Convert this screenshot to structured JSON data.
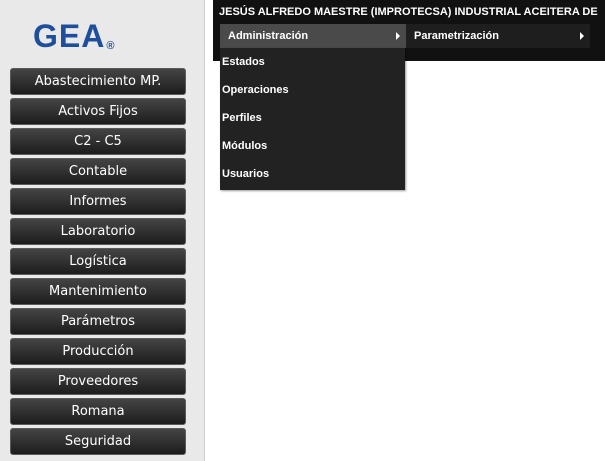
{
  "logo": {
    "text": "GEA",
    "mark": "®"
  },
  "header": {
    "user": "JESÚS ALFREDO MAESTRE (IMPROTECSA) INDUSTRIAL ACEITERA DE"
  },
  "top_menu": [
    {
      "label": "Administración",
      "has_submenu": true,
      "active": true
    },
    {
      "label": "Parametrización",
      "has_submenu": true,
      "active": false
    }
  ],
  "dropdown": {
    "items": [
      "Estados",
      "Operaciones",
      "Perfiles",
      "Módulos",
      "Usuarios"
    ]
  },
  "side_menu": {
    "items": [
      "Abastecimiento MP.",
      "Activos Fijos",
      "C2 - C5",
      "Contable",
      "Informes",
      "Laboratorio",
      "Logística",
      "Mantenimiento",
      "Parámetros",
      "Producción",
      "Proveedores",
      "Romana",
      "Seguridad"
    ]
  },
  "colors": {
    "logo": "#1e4f9c",
    "menu_bar": "#111111",
    "menu_active": "#4a4a4a",
    "button": "#333333"
  }
}
